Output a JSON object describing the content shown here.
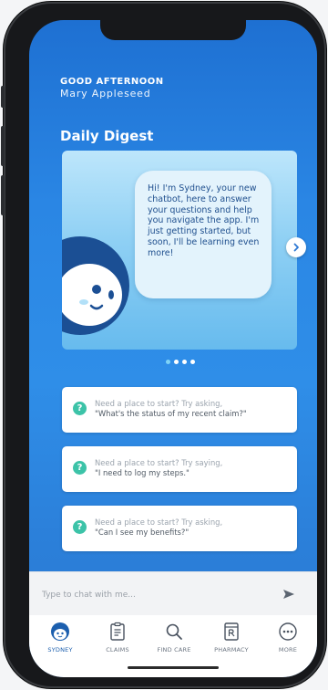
{
  "header": {
    "greeting": "GOOD AFTERNOON",
    "user_name": "Mary Appleseed"
  },
  "digest": {
    "title": "Daily Digest",
    "message": "Hi! I'm Sydney, your new chatbot, here to answer your questions and help you navigate the app. I'm just getting started, but soon, I'll be learning even more!",
    "page_count": 4,
    "current_page": 1
  },
  "suggestions": [
    {
      "lead": "Need a place to start? Try asking,",
      "quote": "\"What's the status of my recent claim?\""
    },
    {
      "lead": "Need a place to start? Try saying,",
      "quote": "\"I need to log my steps.\""
    },
    {
      "lead": "Need a place to start? Try asking,",
      "quote": "\"Can I see my benefits?\""
    }
  ],
  "chat": {
    "placeholder": "Type to chat with me..."
  },
  "tabs": [
    {
      "label": "SYDNEY",
      "icon": "sydney-mascot-icon",
      "active": true
    },
    {
      "label": "CLAIMS",
      "icon": "clipboard-icon",
      "active": false
    },
    {
      "label": "FIND CARE",
      "icon": "search-icon",
      "active": false
    },
    {
      "label": "PHARMACY",
      "icon": "prescription-icon",
      "active": false
    },
    {
      "label": "MORE",
      "icon": "more-icon",
      "active": false
    }
  ],
  "colors": {
    "screen_gradient_top": "#1e70d2",
    "screen_gradient_bottom": "#2a7bd4",
    "card_bubble_text": "#1f4f8e",
    "help_icon": "#3cc3a8",
    "active_tab": "#1c5fae",
    "mascot_navy": "#1b4f94"
  }
}
